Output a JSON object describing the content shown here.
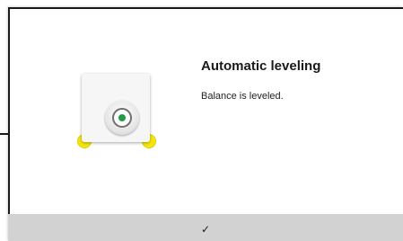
{
  "dialog": {
    "title": "Automatic leveling",
    "message": "Balance is leveled.",
    "confirm_icon": "✓",
    "icon_name": "level-balanced-icon"
  },
  "colors": {
    "bubble": "#1f9a45",
    "feet": "#f5e60f",
    "confirm_bar": "#d2d2d2"
  }
}
